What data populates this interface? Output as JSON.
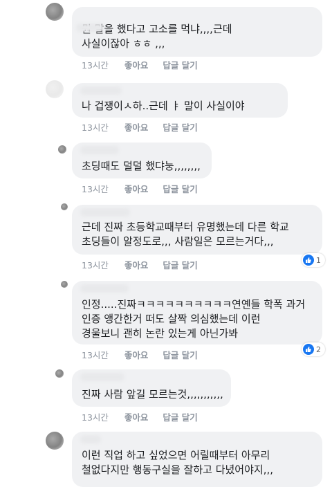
{
  "comments": [
    {
      "lines": [
        "뭔 말을 했다고 고소를 먹냐,,,,근데",
        "사실이잖아 ㅎㅎ ,,,"
      ],
      "time": "13시간",
      "like": "좋아요",
      "reply": "답글 달기"
    },
    {
      "lines": [
        "나 겁쟁이ㅅ하..근데 ㅑ 말이 사실이야"
      ],
      "time": "13시간",
      "like": "좋아요",
      "reply": "답글 달기"
    },
    {
      "lines": [
        "초딩때도 덜덜 했댜눙,,,,,,,,"
      ],
      "time": "13시간",
      "like": "좋아요",
      "reply": "답글 달기"
    },
    {
      "lines": [
        "근데 진짜 초등학교때부터 유명했는데 다른 학교",
        "초딩들이 알정도로,,, 사람일은 모르는거다,,,"
      ],
      "time": "13시간",
      "like": "좋아요",
      "reply": "답글 달기",
      "reaction_count": "1"
    },
    {
      "lines": [
        "인정.....진짜ㅋㅋㅋㅋㅋㅋㅋㅋㅋㅋ연옌들 학폭 과거",
        "인증 앵간한거 떠도 살짝 의심했는데 이런",
        "경울보니 괜히 논란 있는게 아닌가봐"
      ],
      "time": "13시간",
      "like": "좋아요",
      "reply": "답글 달기",
      "reaction_count": "2"
    },
    {
      "lines": [
        "진짜 사람 앞길 모르는것,,,,,,,,,,,"
      ],
      "time": "13시간",
      "like": "좋아요",
      "reply": "답글 달기"
    },
    {
      "lines": [
        "이런 직업 하고 싶었으면 어릴때부터 아무리",
        "철없다지만 행동구실을 잘하고 다녔어야지,,,"
      ]
    }
  ]
}
